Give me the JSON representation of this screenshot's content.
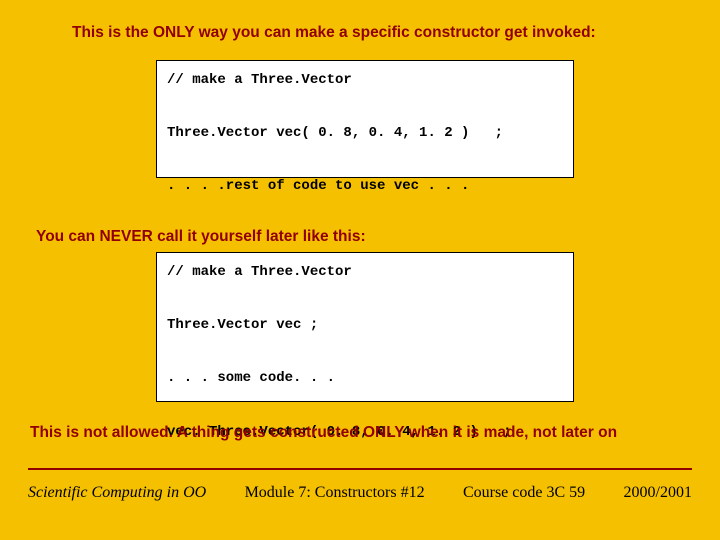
{
  "heading1": "This is the ONLY way you can make a specific constructor get invoked:",
  "codebox1": "// make a Three.Vector\n\nThree.Vector vec( 0. 8, 0. 4, 1. 2 )   ;\n\n. . . .rest of code to use vec . . .",
  "heading2": "You can NEVER call it yourself later like this:",
  "codebox2": "// make a Three.Vector\n\nThree.Vector vec ;\n\n. . . some code. . .\n\nvec. Three.Vector( 0. 8, 0. 4, 1. 2 )   ;",
  "heading3": "This is not allowed.  A thing gets constructed ONLY when it is made, not later on",
  "footer": {
    "left": "Scientific Computing in OO",
    "mid": "Module 7: Constructors    #12",
    "course": "Course code 3C 59",
    "year": "2000/2001"
  }
}
